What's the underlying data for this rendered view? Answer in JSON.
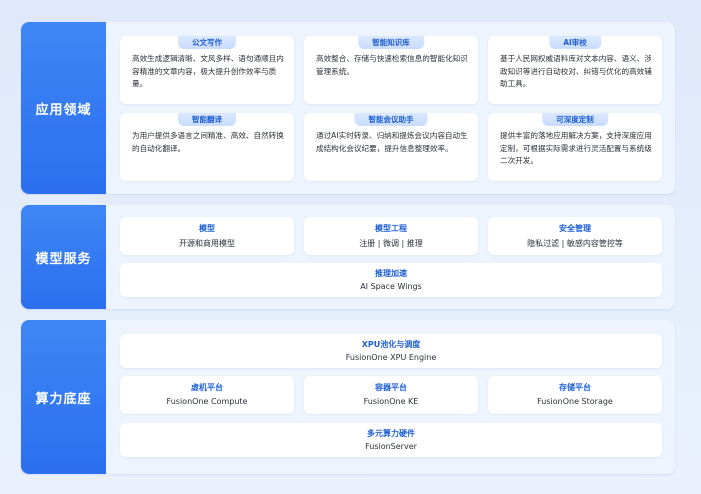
{
  "applications": {
    "label": "应用领域",
    "cards": [
      {
        "title": "公文写作",
        "desc": "高效生成逻辑清晰、文风多样、语句通顺且内容精准的文章内容，极大提升创作效率与质量。"
      },
      {
        "title": "智能知识库",
        "desc": "高效整合、存储与快速检索信息的智能化知识管理系统。"
      },
      {
        "title": "AI审校",
        "desc": "基于人民网权威语料库对文本内容、语义、涉政知识等进行自动校对、纠错与优化的高效辅助工具。"
      },
      {
        "title": "智能翻译",
        "desc": "为用户提供多语言之间精准、高效、自然转换的自动化翻译。"
      },
      {
        "title": "智能会议助手",
        "desc": "通过AI实时转录、归纳和提炼会议内容自动生成结构化会议纪要，提升信息整理效率。"
      },
      {
        "title": "可深度定制",
        "desc": "提供丰富的落地应用解决方案，支持深度应用定制，可根据实际需求进行灵活配置与系统级二次开发。"
      }
    ]
  },
  "model_services": {
    "label": "模型服务",
    "cards": [
      {
        "title": "模型",
        "sub": "开源和商用模型"
      },
      {
        "title": "模型工程",
        "sub": "注册 | 微调 | 推理"
      },
      {
        "title": "安全管理",
        "sub": "隐私过滤 | 敏感内容管控等"
      },
      {
        "title": "推理加速",
        "sub": "AI Space Wings"
      }
    ]
  },
  "compute": {
    "label": "算力底座",
    "cards": [
      {
        "title": "XPU池化与调度",
        "sub": "FusionOne XPU Engine"
      },
      {
        "title": "虚机平台",
        "sub": "FusionOne Compute"
      },
      {
        "title": "容器平台",
        "sub": "FusionOne KE"
      },
      {
        "title": "存储平台",
        "sub": "FusionOne Storage"
      },
      {
        "title": "多元算力硬件",
        "sub": "FusionServer"
      }
    ]
  },
  "colors": {
    "accent": "#2b6ff0",
    "title_blue": "#1f5fd1",
    "tab_bg": "#c9dcff"
  }
}
